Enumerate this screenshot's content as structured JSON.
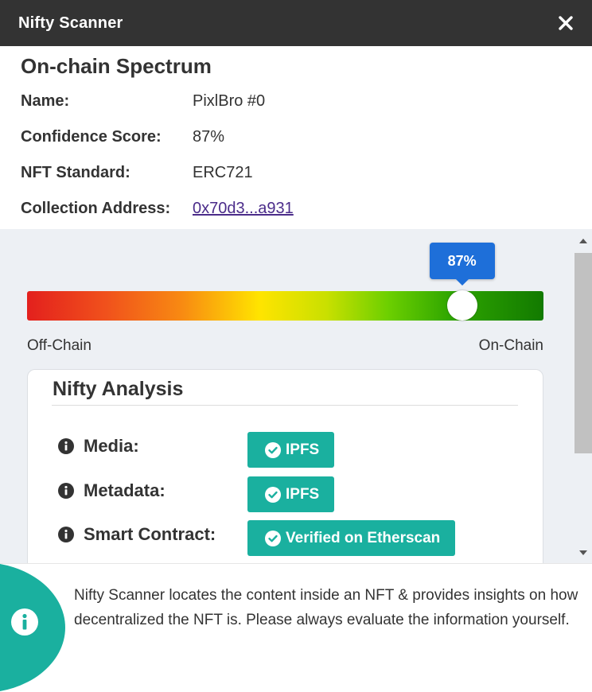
{
  "header": {
    "title": "Nifty Scanner",
    "close_icon": "close-icon"
  },
  "info": {
    "title": "On-chain Spectrum",
    "rows": [
      {
        "label": "Name:",
        "value": "PixlBro #0"
      },
      {
        "label": "Confidence Score:",
        "value": "87%"
      },
      {
        "label": "NFT Standard:",
        "value": "ERC721"
      },
      {
        "label": "Collection Address:",
        "value": "0x70d3...a931"
      }
    ]
  },
  "spectrum": {
    "value_pct": 87,
    "tooltip": "87%",
    "left_label": "Off-Chain",
    "right_label": "On-Chain"
  },
  "analysis": {
    "title": "Nifty Analysis",
    "items": [
      {
        "label": "Media:",
        "badge": "IPFS"
      },
      {
        "label": "Metadata:",
        "badge": "IPFS"
      },
      {
        "label": "Smart Contract:",
        "badge": "Verified on Etherscan"
      }
    ]
  },
  "footer": {
    "text": "Nifty Scanner locates the content inside an NFT & provides insights on how decentralized the NFT is. Please always evaluate the information yourself."
  },
  "colors": {
    "header_bg": "#333333",
    "accent_teal": "#1ab09f",
    "tooltip_blue": "#1e6fd9",
    "link": "#4b2c8a"
  }
}
